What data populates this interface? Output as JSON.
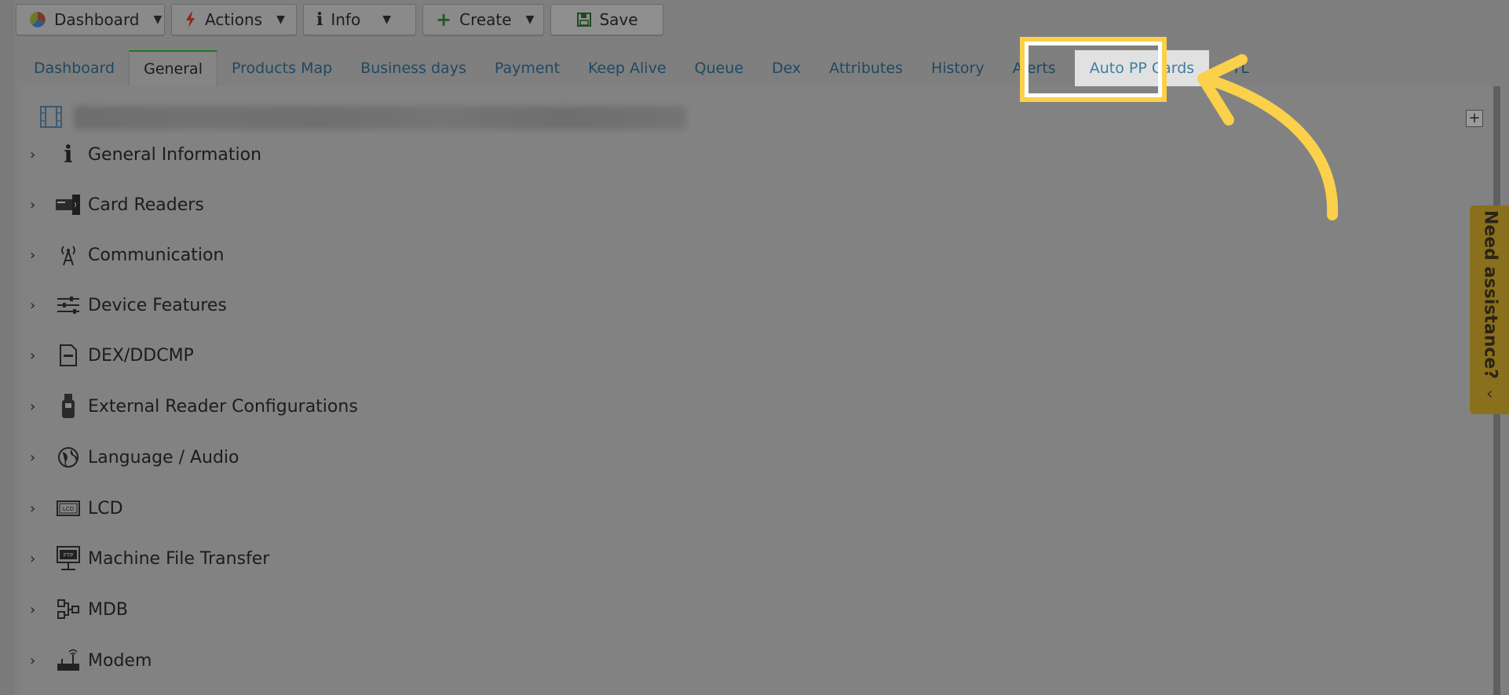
{
  "toolbar": {
    "dashboard_label": "Dashboard",
    "actions_label": "Actions",
    "info_label": "Info",
    "create_label": "Create",
    "save_label": "Save"
  },
  "tabs": [
    {
      "label": "Dashboard",
      "state": "normal"
    },
    {
      "label": "General",
      "state": "active"
    },
    {
      "label": "Products Map",
      "state": "normal"
    },
    {
      "label": "Business days",
      "state": "normal"
    },
    {
      "label": "Payment",
      "state": "normal"
    },
    {
      "label": "Keep Alive",
      "state": "normal"
    },
    {
      "label": "Queue",
      "state": "normal"
    },
    {
      "label": "Dex",
      "state": "normal"
    },
    {
      "label": "Attributes",
      "state": "normal"
    },
    {
      "label": "History",
      "state": "normal"
    },
    {
      "label": "Alerts",
      "state": "normal"
    },
    {
      "label": "Auto PP Cards",
      "state": "highlighted"
    },
    {
      "label": "FTL",
      "state": "normal"
    }
  ],
  "sections": [
    {
      "label": "General Information",
      "icon": "info-icon"
    },
    {
      "label": "Card Readers",
      "icon": "card-reader-icon"
    },
    {
      "label": "Communication",
      "icon": "antenna-icon"
    },
    {
      "label": "Device Features",
      "icon": "sliders-icon"
    },
    {
      "label": "DEX/DDCMP",
      "icon": "document-icon"
    },
    {
      "label": "External Reader Configurations",
      "icon": "external-reader-icon"
    },
    {
      "label": "Language / Audio",
      "icon": "globe-audio-icon"
    },
    {
      "label": "LCD",
      "icon": "lcd-icon"
    },
    {
      "label": "Machine File Transfer",
      "icon": "ftp-icon"
    },
    {
      "label": "MDB",
      "icon": "mdb-icon"
    },
    {
      "label": "Modem",
      "icon": "modem-icon"
    }
  ],
  "assistance": {
    "label": "Need assistance?"
  },
  "colors": {
    "highlight": "#fbd04a",
    "overlay": "#7f7f7f",
    "link": "#1f4863",
    "active_tab_border": "#1a7a1a"
  }
}
